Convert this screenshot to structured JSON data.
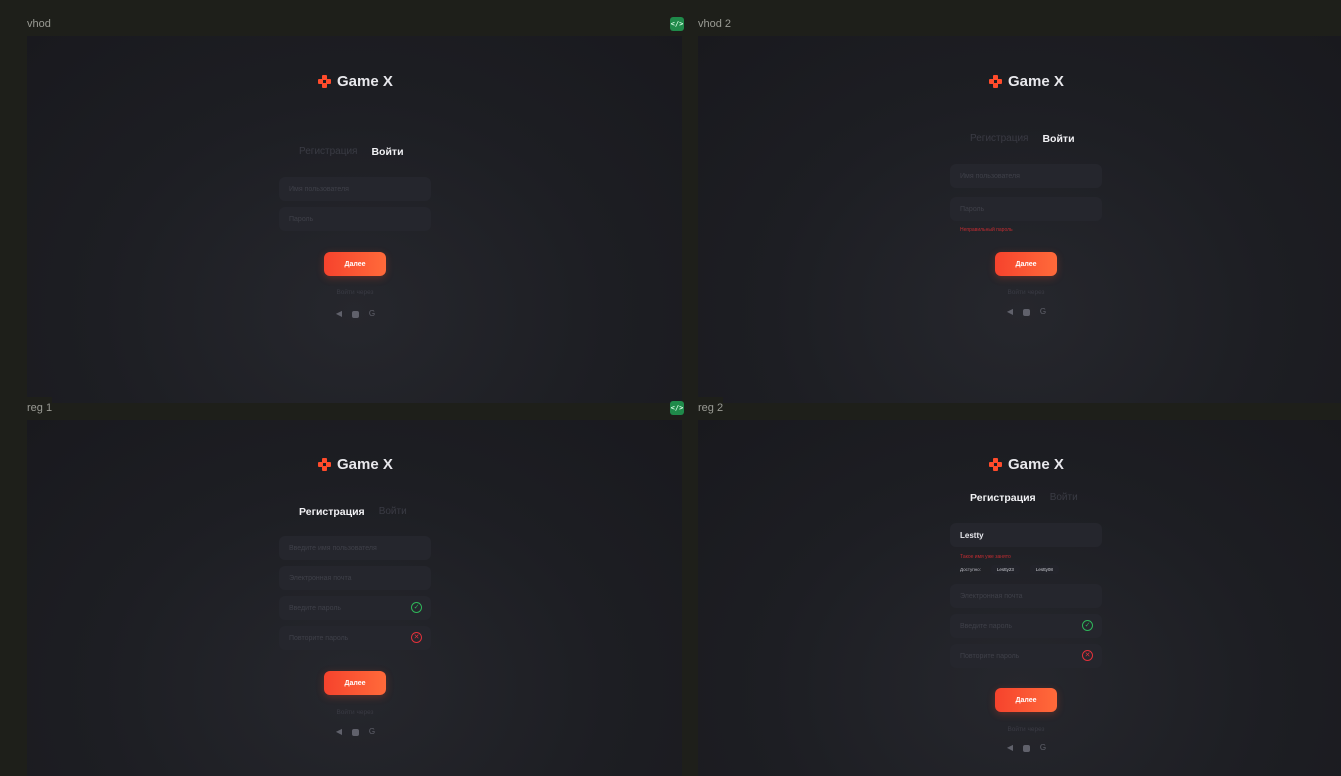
{
  "code_badge": "</>",
  "frames": [
    {
      "label": "vhod",
      "logo": "Game X",
      "tabs": {
        "register": "Регистрация",
        "login": "Войти"
      },
      "fields": [
        {
          "placeholder": "Имя пользователя"
        },
        {
          "placeholder": "Пароль"
        }
      ],
      "button": "Далее",
      "via": "Войти через"
    },
    {
      "label": "vhod 2",
      "logo": "Game X",
      "tabs": {
        "register": "Регистрация",
        "login": "Войти"
      },
      "fields": [
        {
          "placeholder": "Имя пользователя"
        },
        {
          "placeholder": "Пароль"
        }
      ],
      "error": "Неправильный пароль",
      "button": "Далее",
      "via": "Войти через"
    },
    {
      "label": "reg 1",
      "logo": "Game X",
      "tabs": {
        "register": "Регистрация",
        "login": "Войти"
      },
      "fields": [
        {
          "placeholder": "Введите имя пользователя"
        },
        {
          "placeholder": "Электронная почта"
        },
        {
          "placeholder": "Введите пароль",
          "status": "ok"
        },
        {
          "placeholder": "Повторите пароль",
          "status": "error"
        }
      ],
      "button": "Далее",
      "via": "Войти через"
    },
    {
      "label": "reg 2",
      "logo": "Game X",
      "tabs": {
        "register": "Регистрация",
        "login": "Войти"
      },
      "fields": [
        {
          "value": "Lestty"
        },
        {
          "placeholder": "Электронная почта"
        },
        {
          "placeholder": "Введите пароль",
          "status": "ok"
        },
        {
          "placeholder": "Повторите пароль",
          "status": "error"
        }
      ],
      "error": "Такое имя уже занято",
      "available": {
        "label": "Доступно:",
        "options": [
          "Lestty23",
          "Lestty08"
        ]
      },
      "button": "Далее",
      "via": "Войти через"
    }
  ],
  "social_icons": [
    "telegram-icon",
    "square-icon",
    "google-icon"
  ],
  "colors": {
    "accent": "#ff4b2b",
    "ok": "#2fb55a",
    "error": "#e2313b",
    "board": "#1e1f1a",
    "frame": "#1d1e23"
  }
}
